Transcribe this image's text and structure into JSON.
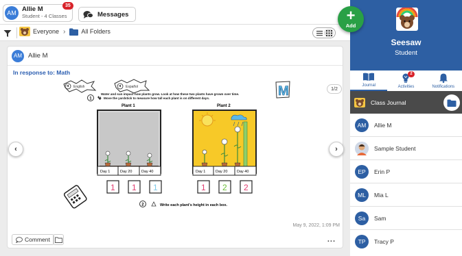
{
  "user": {
    "initials": "AM",
    "name": "Allie M",
    "subtitle": "Student - 4 Classes",
    "badge": "35"
  },
  "messages": {
    "label": "Messages"
  },
  "breadcrumb": {
    "group": "Everyone",
    "separator": "›",
    "folder": "All Folders"
  },
  "fab": {
    "plus": "+",
    "label": "Add"
  },
  "post": {
    "author_initials": "AM",
    "author": "Allie M",
    "in_response": "In response to: Math",
    "page_counter": "1/2",
    "timestamp": "May 9, 2022, 1:09 PM",
    "comment_label": "Comment",
    "more": "...",
    "prev_arrow": "‹",
    "next_arrow": "›",
    "worksheet": {
      "lang1": "English",
      "lang2": "Español",
      "instruction_line1": "Water and sun impact how plants grow.  Look at how these two plants have grown over time.",
      "instruction_line2": "Move the yardstick to measure how tall each plant is on different days.",
      "step1": "1",
      "step2": "2",
      "plant1_title": "Plant 1",
      "plant2_title": "Plant 2",
      "days": [
        "Day 1",
        "Day 20",
        "Day 40"
      ],
      "plant1_answers": [
        "1",
        "1",
        "1"
      ],
      "plant2_answers": [
        "1",
        "2",
        "2"
      ],
      "instruction2": "Write each plant's height in each box.",
      "logo_letter": "M"
    }
  },
  "sidebar": {
    "app_name": "Seesaw",
    "role": "Student",
    "nav": [
      {
        "label": "Journal",
        "icon": "book-icon"
      },
      {
        "label": "Activities",
        "icon": "lightbulb-icon",
        "badge": "2"
      },
      {
        "label": "Notifications",
        "icon": "bell-icon"
      }
    ],
    "class_name": "Class Journal",
    "students": [
      {
        "initials": "AM",
        "name": "Allie M"
      },
      {
        "initials": "",
        "name": "Sample Student"
      },
      {
        "initials": "EP",
        "name": "Erin P"
      },
      {
        "initials": "ML",
        "name": "Mia L"
      },
      {
        "initials": "Sa",
        "name": "Sam"
      },
      {
        "initials": "TP",
        "name": "Tracy P"
      }
    ]
  },
  "colors": {
    "brand_blue": "#2d5fa3",
    "add_green": "#29a046",
    "badge_red": "#d8232a",
    "class_row": "#4a4a4a"
  }
}
